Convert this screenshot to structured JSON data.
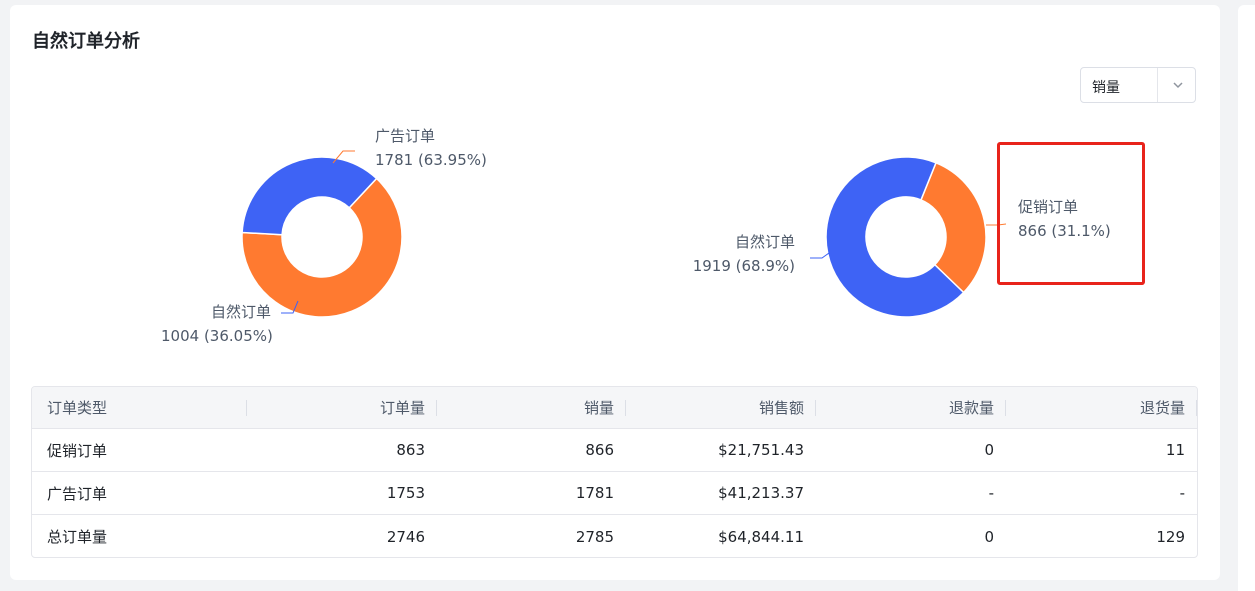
{
  "title": "自然订单分析",
  "metric_select": {
    "value": "销量"
  },
  "colors": {
    "organic": "#3e63f5",
    "ad": "#ff7a30",
    "promo": "#ff7a30",
    "highlight": "#e8231b"
  },
  "left_donut": {
    "slices": [
      {
        "name": "广告订单",
        "value": 1781,
        "text": "1781 (63.95%)",
        "color": "#ff7a30"
      },
      {
        "name": "自然订单",
        "value": 1004,
        "text": "1004 (36.05%)",
        "color": "#3e63f5"
      }
    ]
  },
  "right_donut": {
    "slices": [
      {
        "name": "促销订单",
        "value": 866,
        "text": "866 (31.1%)",
        "color": "#ff7a30"
      },
      {
        "name": "自然订单",
        "value": 1919,
        "text": "1919 (68.9%)",
        "color": "#3e63f5"
      }
    ]
  },
  "table": {
    "headers": [
      "订单类型",
      "订单量",
      "销量",
      "销售额",
      "退款量",
      "退货量"
    ],
    "rows": [
      [
        "促销订单",
        "863",
        "866",
        "$21,751.43",
        "0",
        "11"
      ],
      [
        "广告订单",
        "1753",
        "1781",
        "$41,213.37",
        "-",
        "-"
      ],
      [
        "总订单量",
        "2746",
        "2785",
        "$64,844.11",
        "0",
        "129"
      ]
    ]
  }
}
